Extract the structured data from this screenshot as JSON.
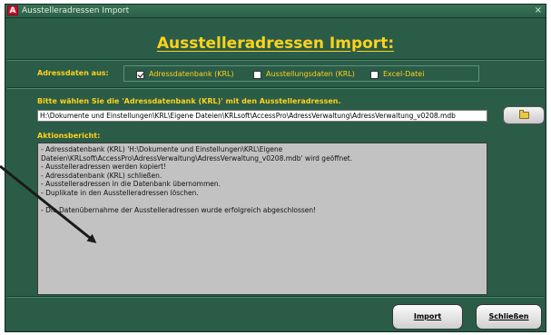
{
  "window": {
    "title": "Ausstelleradressen Import",
    "close_glyph": "×"
  },
  "heading": "Ausstelleradressen Import:",
  "source": {
    "label": "Adressdaten aus:",
    "options": [
      {
        "label": "Adressdatenbank (KRL)",
        "checked": true
      },
      {
        "label": "Ausstellungsdaten (KRL)",
        "checked": false
      },
      {
        "label": "Excel-Datei",
        "checked": false
      }
    ]
  },
  "file": {
    "prompt": "Bitte wählen Sie die 'Adressdatenbank (KRL)' mit den Ausstelleradressen.",
    "path": "H:\\Dokumente und Einstellungen\\KRL\\Eigene Dateien\\KRLsoft\\AccessPro\\AdressVerwaltung\\AdressVerwaltung_v0208.mdb",
    "browse_icon": "folder-icon"
  },
  "report": {
    "label": "Aktionsbericht:",
    "lines": [
      "- Adressdatenbank (KRL) 'H:\\Dokumente und Einstellungen\\KRL\\Eigene Dateien\\KRLsoft\\AccessPro\\AdressVerwaltung\\AdressVerwaltung_v0208.mdb' wird geöffnet.",
      "- Ausstelleradressen werden kopiert!",
      "- Adressdatenbank (KRL) schließen.",
      "- Ausstelleradressen in die Datenbank übernommen.",
      "- Duplikate in den Ausstelleradressen löschen.",
      "",
      "- Die Datenübernahme der Ausstelleradressen wurde erfolgreich abgeschlossen!"
    ]
  },
  "buttons": {
    "import": "Import",
    "close": "Schließen"
  },
  "colors": {
    "window_bg": "#2b5c48",
    "label_yellow": "#ffd21a",
    "report_bg": "#c2c2c2"
  }
}
